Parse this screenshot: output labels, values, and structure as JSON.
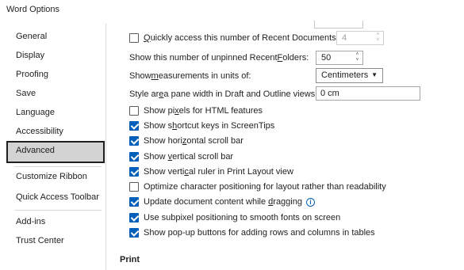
{
  "window": {
    "title": "Word Options"
  },
  "sidebar": {
    "items": [
      {
        "label": "General"
      },
      {
        "label": "Display"
      },
      {
        "label": "Proofing"
      },
      {
        "label": "Save"
      },
      {
        "label": "Language"
      },
      {
        "label": "Accessibility"
      },
      {
        "label": "Advanced"
      },
      {
        "label": "Customize Ribbon"
      },
      {
        "label": "Quick Access Toolbar"
      },
      {
        "label": "Add-ins"
      },
      {
        "label": "Trust Center"
      }
    ],
    "selected": "Advanced"
  },
  "options": {
    "quick_access": {
      "label_pre": "",
      "label_u": "Q",
      "label_post": "uickly access this number of Recent Documents:",
      "checked": false,
      "value": "4"
    },
    "unpinned_folders": {
      "label_pre": "Show this number of unpinned Recent ",
      "label_u": "F",
      "label_post": "olders:",
      "value": "50"
    },
    "units": {
      "label_pre": "Show ",
      "label_u": "m",
      "label_post": "easurements in units of:",
      "value": "Centimeters",
      "chevron": "▼"
    },
    "style_area": {
      "label_pre": "Style ar",
      "label_u": "e",
      "label_post": "a pane width in Draft and Outline views:",
      "value": "0 cm"
    },
    "checkboxes": [
      {
        "label_pre": "Show pi",
        "label_u": "x",
        "label_post": "els for HTML features",
        "checked": false
      },
      {
        "label_pre": "Show s",
        "label_u": "h",
        "label_post": "ortcut keys in ScreenTips",
        "checked": true
      },
      {
        "label_pre": "Show hori",
        "label_u": "z",
        "label_post": "ontal scroll bar",
        "checked": true
      },
      {
        "label_pre": "Show ",
        "label_u": "v",
        "label_post": "ertical scroll bar",
        "checked": true
      },
      {
        "label_pre": "Show verti",
        "label_u": "c",
        "label_post": "al ruler in Print Layout view",
        "checked": true
      },
      {
        "label_pre": "Optimize character positioning for layout rather than readability",
        "label_u": "",
        "label_post": "",
        "checked": false
      },
      {
        "label_pre": "Update document content while ",
        "label_u": "d",
        "label_post": "ragging",
        "checked": true,
        "info": true
      },
      {
        "label_pre": "Use subpixel positioning to smooth fonts on screen",
        "label_u": "",
        "label_post": "",
        "checked": true
      },
      {
        "label_pre": "Show pop-up buttons for adding rows and columns in tables",
        "label_u": "",
        "label_post": "",
        "checked": true
      }
    ]
  },
  "sections": {
    "print": "Print"
  },
  "icons": {
    "spin_up": "˄",
    "spin_down": "˅",
    "info": "i"
  },
  "colors": {
    "accent": "#005fb8",
    "selected_bg": "#d3d3d3"
  }
}
